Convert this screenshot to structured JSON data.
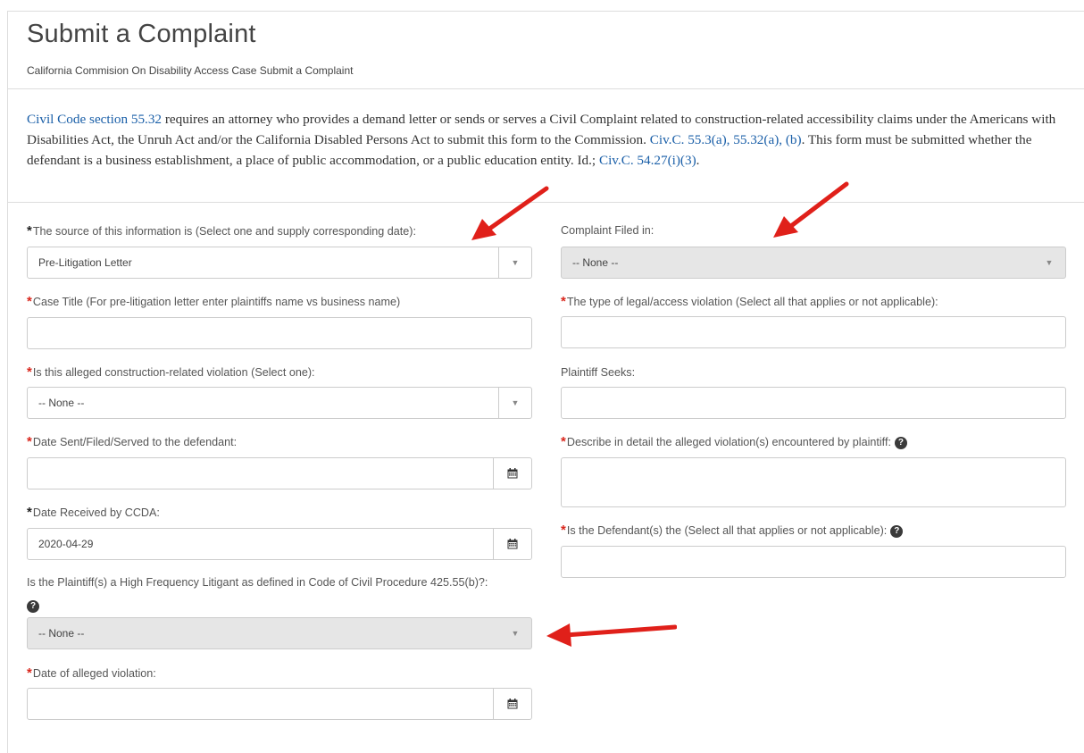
{
  "header": {
    "title": "Submit a Complaint",
    "subtitle": "California Commision On Disability Access Case Submit a Complaint"
  },
  "intro": {
    "link1": "Civil Code section 55.32",
    "text1": " requires an attorney who provides a demand letter or sends or serves a Civil Complaint related to construction-related accessibility claims under the Americans with Disabilities Act, the Unruh Act and/or the California Disabled Persons Act to submit this form to the Commission. ",
    "link2": "Civ.C. 55.3(a), 55.32(a), (b)",
    "text2": ". This form must be submitted whether the defendant is a business establishment, a place of public accommodation, or a public education entity. Id.; ",
    "link3": "Civ.C. 54.27(i)(3)",
    "text3": "."
  },
  "form": {
    "source": {
      "label": "The source of this information is (Select one and supply corresponding date):",
      "value": "Pre-Litigation Letter"
    },
    "complaint_filed": {
      "label": "Complaint Filed in:",
      "value": "-- None --"
    },
    "case_title": {
      "label": "Case Title (For pre-litigation letter enter plaintiffs name vs business name)",
      "value": ""
    },
    "violation_type": {
      "label": "The type of legal/access violation (Select all that applies or not applicable):",
      "value": ""
    },
    "construction_related": {
      "label": "Is this alleged construction-related violation (Select one):",
      "value": "-- None --"
    },
    "plaintiff_seeks": {
      "label": "Plaintiff Seeks:",
      "value": ""
    },
    "date_sent": {
      "label": "Date Sent/Filed/Served to the defendant:",
      "value": ""
    },
    "describe": {
      "label": "Describe in detail the alleged violation(s) encountered by plaintiff:",
      "value": ""
    },
    "date_received": {
      "label": "Date Received by CCDA:",
      "value": "2020-04-29"
    },
    "defendant_is": {
      "label": "Is the Defendant(s) the (Select all that applies or not applicable):",
      "value": ""
    },
    "high_freq": {
      "label": "Is the Plaintiff(s) a High Frequency Litigant as defined in Code of Civil Procedure 425.55(b)?:",
      "value": "-- None --"
    },
    "date_violation": {
      "label": "Date of alleged violation:",
      "value": ""
    }
  },
  "markers": {
    "required": "*",
    "help": "?",
    "caret": "▼"
  },
  "colors": {
    "link": "#1a5fa8",
    "required": "#d9261c",
    "arrow": "#e0201a"
  },
  "icons": [
    "calendar-icon",
    "help-icon",
    "dropdown-caret-icon",
    "red-arrow-annotation"
  ]
}
